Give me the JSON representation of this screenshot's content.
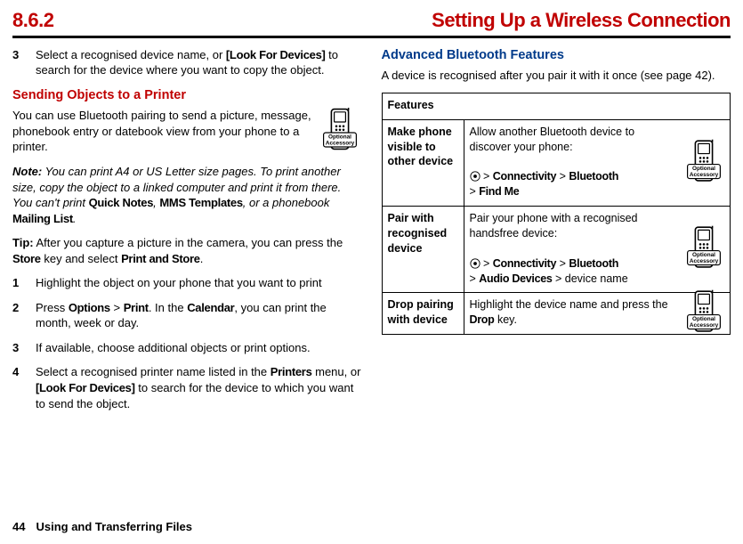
{
  "header": {
    "section_number": "8.6.2",
    "title": "Setting Up a Wireless Connection"
  },
  "left": {
    "step3_num": "3",
    "step3_txt_a": "Select a recognised device name, or ",
    "step3_txt_look": "[Look For Devices]",
    "step3_txt_b": " to search for the device where you want to copy the object.",
    "sending_heading": "Sending Objects to a Printer",
    "sending_body": "You can use Bluetooth pairing to send a picture, message, phonebook entry or datebook view from your phone to a printer.",
    "note_label": "Note:",
    "note_a": " You can print A4 or US Letter size pages. To print another size, copy the object to a linked computer and print it from there. You can't print ",
    "note_qn": "Quick Notes",
    "note_c1": ", ",
    "note_mms": "MMS Templates",
    "note_c2": ", or a phonebook ",
    "note_ml": "Mailing List",
    "note_end": ".",
    "tip_label": "Tip:",
    "tip_a": " After you capture a picture in the camera, you can press the ",
    "tip_store": "Store",
    "tip_b": " key and select ",
    "tip_pas": "Print and Store",
    "tip_end": ".",
    "s1_num": "1",
    "s1_txt": "Highlight the object on your phone that you want to print",
    "s2_num": "2",
    "s2_a": "Press ",
    "s2_options": "Options",
    "s2_gt1": " > ",
    "s2_print": "Print",
    "s2_b": ". In the ",
    "s2_cal": "Calendar",
    "s2_c": ", you can print the month, week or day.",
    "s3b_num": "3",
    "s3b_txt": "If available, choose additional objects or print options.",
    "s4_num": "4",
    "s4_a": "Select a recognised printer name listed in the ",
    "s4_printers": "Printers",
    "s4_b": " menu, or ",
    "s4_look": "[Look For Devices]",
    "s4_c": " to search for the device to which you want to send the object."
  },
  "right": {
    "adv_heading": "Advanced Bluetooth Features",
    "adv_body": "A device is recognised after you pair it with it once (see page 42).",
    "features_label": "Features",
    "r1_label": "Make phone visible to other device",
    "r1_a": "Allow another Bluetooth device to discover your phone:",
    "r1_nav_conn": "Connectivity",
    "r1_nav_bt": "Bluetooth",
    "r1_nav_fm": "Find Me",
    "r2_label": "Pair with recognised device",
    "r2_a": "Pair your phone with a recognised handsfree device:",
    "r2_nav_conn": "Connectivity",
    "r2_nav_bt": "Bluetooth",
    "r2_nav_ad": "Audio Devices",
    "r2_nav_dev": "device name",
    "r3_label": "Drop pairing with device",
    "r3_a": "Highlight the device name and press the ",
    "r3_drop": "Drop",
    "r3_b": " key."
  },
  "icon": {
    "label": "Optional Accessory"
  },
  "nav_sep": " > ",
  "center_dot": "s",
  "footer": {
    "page": "44",
    "chapter": "Using and Transferring Files"
  }
}
